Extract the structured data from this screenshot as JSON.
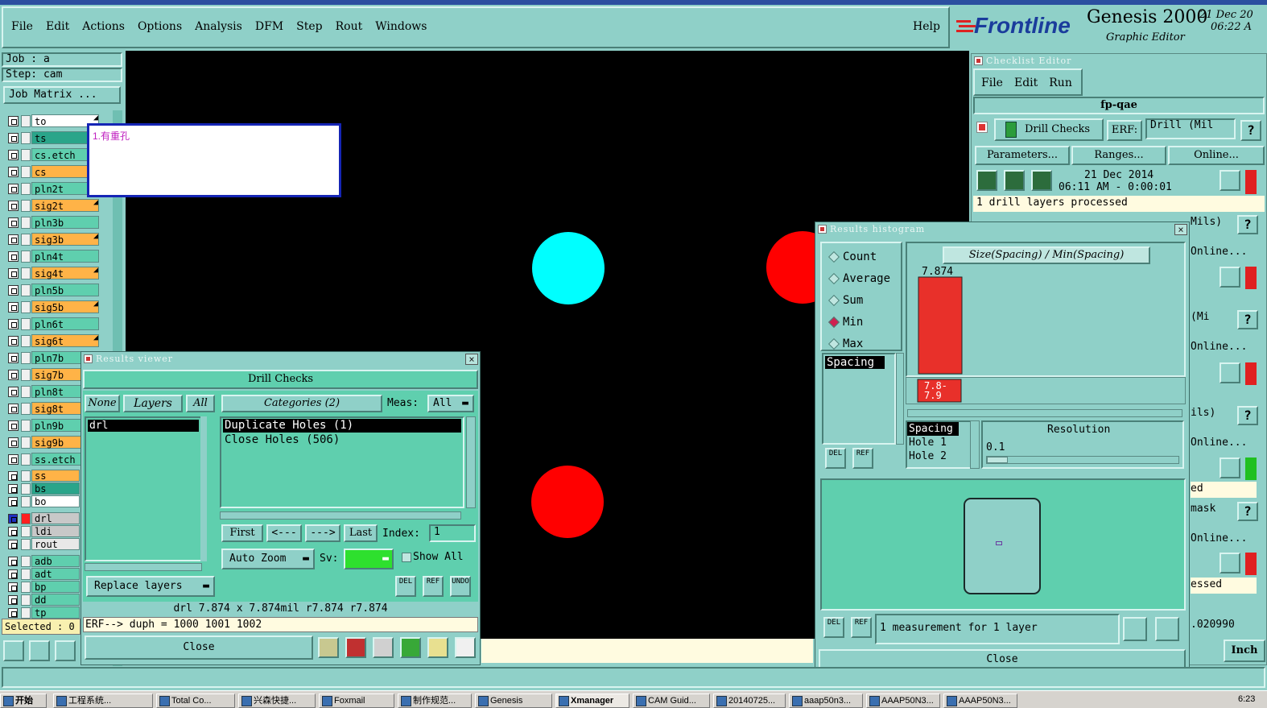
{
  "menu": {
    "items": [
      "File",
      "Edit",
      "Actions",
      "Options",
      "Analysis",
      "DFM",
      "Step",
      "Rout",
      "Windows"
    ],
    "help": "Help"
  },
  "brand": {
    "logo": "Frontline",
    "product": "Genesis 2000",
    "subtitle": "Graphic Editor",
    "date": "21 Dec 20",
    "time": "06:22 A"
  },
  "job": {
    "job": "Job : a",
    "step": "Step: cam",
    "matrix": "Job Matrix ..."
  },
  "layers": [
    {
      "name": "to",
      "color": "#ffffff",
      "arrow": true
    },
    {
      "name": "ts",
      "color": "#2aa58a",
      "arrow": false
    },
    {
      "name": "cs.etch",
      "color": "#5fcfae",
      "arrow": false
    },
    {
      "name": "cs",
      "color": "#ffb347",
      "arrow": false
    },
    {
      "name": "pln2t",
      "color": "#5fcfae",
      "arrow": false
    },
    {
      "name": "sig2t",
      "color": "#ffb347",
      "arrow": true
    },
    {
      "name": "pln3b",
      "color": "#5fcfae",
      "arrow": false
    },
    {
      "name": "sig3b",
      "color": "#ffb347",
      "arrow": true
    },
    {
      "name": "pln4t",
      "color": "#5fcfae",
      "arrow": false
    },
    {
      "name": "sig4t",
      "color": "#ffb347",
      "arrow": true
    },
    {
      "name": "pln5b",
      "color": "#5fcfae",
      "arrow": false
    },
    {
      "name": "sig5b",
      "color": "#ffb347",
      "arrow": true
    },
    {
      "name": "pln6t",
      "color": "#5fcfae",
      "arrow": false
    },
    {
      "name": "sig6t",
      "color": "#ffb347",
      "arrow": true
    },
    {
      "name": "pln7b",
      "color": "#5fcfae",
      "arrow": false
    },
    {
      "name": "sig7b",
      "color": "#ffb347",
      "arrow": false
    },
    {
      "name": "pln8t",
      "color": "#5fcfae",
      "arrow": false
    },
    {
      "name": "sig8t",
      "color": "#ffb347",
      "arrow": false
    },
    {
      "name": "pln9b",
      "color": "#5fcfae",
      "arrow": false
    },
    {
      "name": "sig9b",
      "color": "#ffb347",
      "arrow": false
    },
    {
      "name": "ss.etch",
      "color": "#5fcfae",
      "arrow": false
    }
  ],
  "layers2": [
    {
      "name": "ss",
      "color": "#ffb347"
    },
    {
      "name": "bs",
      "color": "#2aa58a"
    },
    {
      "name": "bo",
      "color": "#ffffff"
    },
    {
      "name": "drl",
      "color": "#c8c8c8",
      "active": true
    },
    {
      "name": "ldi",
      "color": "#c8c8c8"
    },
    {
      "name": "rout",
      "color": "#e8e8e8"
    },
    {
      "name": "adb",
      "color": "#5fcfae"
    },
    {
      "name": "adt",
      "color": "#5fcfae"
    },
    {
      "name": "bp",
      "color": "#5fcfae"
    },
    {
      "name": "dd",
      "color": "#5fcfae"
    },
    {
      "name": "tp",
      "color": "#5fcfae"
    }
  ],
  "selected": "Selected : 0",
  "note": "1.有重孔",
  "checklist": {
    "title": "Checklist Editor",
    "menu": [
      "File",
      "Edit",
      "Run"
    ],
    "name": "fp-qae",
    "check": "Drill Checks",
    "erf_label": "ERF:",
    "erf_value": "Drill (Mil",
    "params": "Parameters...",
    "ranges": "Ranges...",
    "online": "Online...",
    "date": "21 Dec 2014",
    "time": "06:11 AM - 0:00:01",
    "status": "1 drill layers processed",
    "side_texts": [
      "Mils)",
      "Online...",
      "(Mi",
      "Online...",
      "ils)",
      "Online...",
      "ed",
      "mask",
      "Online...",
      "essed",
      ".020990"
    ],
    "inch": "Inch",
    "help": "?"
  },
  "results_viewer": {
    "title": "Results viewer",
    "header": "Drill Checks",
    "none": "None",
    "layers": "Layers",
    "all": "All",
    "categories": "Categories (2)",
    "meas": "Meas:",
    "meas_value": "All",
    "layer_items": [
      "drl"
    ],
    "category_items": [
      "Duplicate Holes (1)",
      "Close Holes (506)"
    ],
    "first": "First",
    "prev": "<---",
    "next": "--->",
    "last": "Last",
    "index_label": "Index:",
    "index_value": "1",
    "auto_zoom": "Auto Zoom",
    "sv": "Sv:",
    "show_all": "Show All",
    "replace": "Replace layers",
    "del": "DEL",
    "ref": "REF",
    "undo": "UNDO",
    "info": "drl  7.874 x 7.874mil   r7.874   r7.874",
    "erf": "ERF--> duph = 1000 1001 1002",
    "close": "Close"
  },
  "histogram": {
    "title": "Results histogram",
    "options": [
      "Count",
      "Average",
      "Sum",
      "Min",
      "Max"
    ],
    "selected_option": "Min",
    "list": [
      "Spacing"
    ],
    "chart_title": "Size(Spacing) / Min(Spacing)",
    "del": "DEL",
    "ref": "REF",
    "detail": [
      "Spacing",
      "Hole 1",
      "Hole 2"
    ],
    "resolution_label": "Resolution",
    "resolution_value": "0.1",
    "status": "1 measurement for 1 layer",
    "close": "Close"
  },
  "chart_data": {
    "type": "bar",
    "title": "Size(Spacing) / Min(Spacing)",
    "categories": [
      "7.8-7.9"
    ],
    "values": [
      7.874
    ],
    "data_labels": [
      "7.874"
    ],
    "color": "#e8302a"
  },
  "canvas": {
    "holes": [
      {
        "color": "#00ffff"
      },
      {
        "color": "#ff0000"
      },
      {
        "color": "#ff0000"
      }
    ]
  },
  "taskbar": {
    "start": "开始",
    "items": [
      "工程系统...",
      "Total Co...",
      "兴森快捷...",
      "Foxmail",
      "制作规范...",
      "Genesis",
      "Xmanager",
      "CAM Guid...",
      "20140725...",
      "aaap50n3...",
      "AAAP50N3...",
      "AAAP50N3..."
    ],
    "clock": "6:23"
  }
}
